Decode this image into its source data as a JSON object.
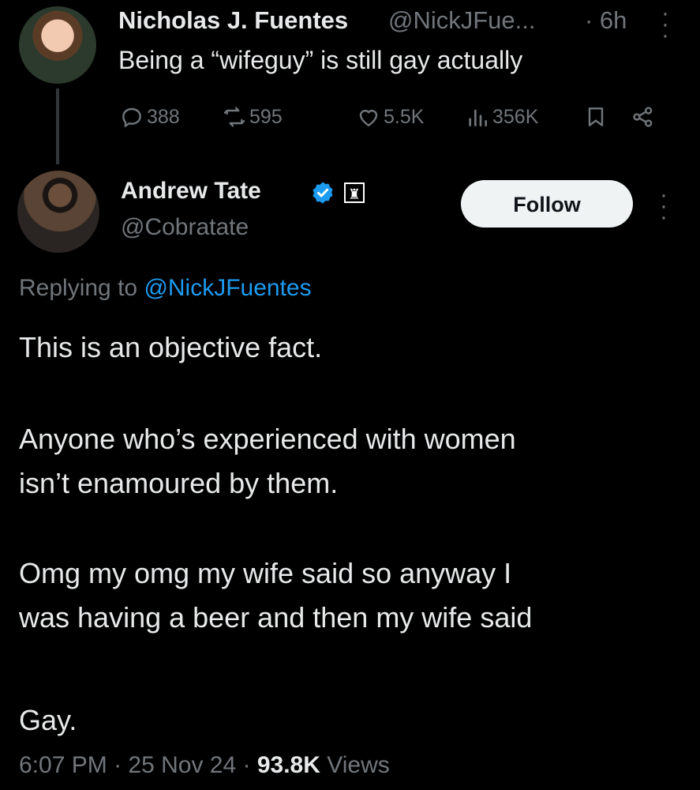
{
  "original_tweet": {
    "name": "Nicholas J. Fuentes",
    "handle": "@NickJFue...",
    "time": "· 6h",
    "text": "Being a “wifeguy” is still gay actually",
    "replies": "388",
    "reposts": "595",
    "likes": "5.5K",
    "views": "356K"
  },
  "reply_tweet": {
    "name": "Andrew Tate",
    "handle": "@Cobratate",
    "follow_label": "Follow",
    "replying_prefix": "Replying to",
    "replying_handle": "@NickJFuentes",
    "paragraphs": [
      "This is an objective fact.",
      "Anyone who’s experienced with women",
      "isn’t enamoured by them.",
      "Omg my omg my wife said so anyway I",
      "was having a beer and then my wife said",
      "Gay."
    ],
    "time": "6:07 PM",
    "date": "25 Nov 24",
    "views_count": "93.8K",
    "views_label": "Views"
  },
  "icons": {
    "reply": "reply-icon",
    "repost": "repost-icon",
    "like": "heart-icon",
    "views": "views-icon",
    "bookmark": "bookmark-icon",
    "share": "share-icon",
    "verified": "verified-badge-icon",
    "affiliate": "affiliate-badge-icon",
    "more": "more-icon"
  },
  "colors": {
    "background": "#000000",
    "text": "#e7e9ea",
    "muted": "#71767b",
    "link": "#1d9bf0",
    "verified": "#1d9bf0"
  }
}
